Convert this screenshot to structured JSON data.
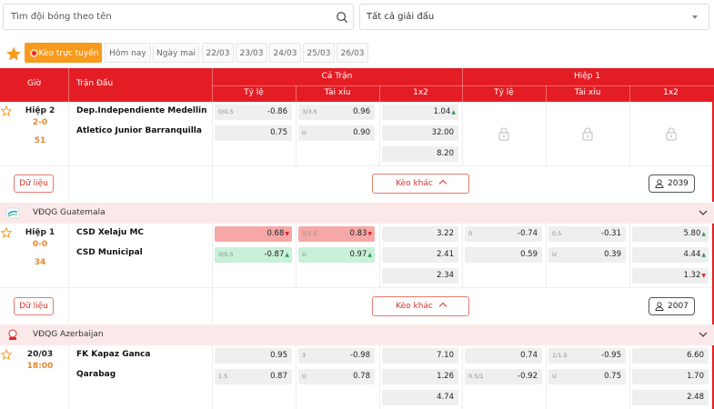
{
  "search": {
    "placeholder": "Tìm đội bóng theo tên",
    "league_select": "Tất cả giải đấu"
  },
  "tabs": [
    "Kèo trực tuyến",
    "Hôm nay",
    "Ngày mai",
    "22/03",
    "23/03",
    "24/03",
    "25/03",
    "26/03"
  ],
  "header": {
    "time": "Giờ",
    "match": "Trận Đấu",
    "full": "Cả Trận",
    "half": "Hiệp 1",
    "handicap": "Tỷ lệ",
    "overunder": "Tài xỉu",
    "onextwo": "1x2"
  },
  "buttons": {
    "data": "Dữ liệu",
    "more": "Kèo khác"
  },
  "leagues": [
    "VĐQG Guatemala",
    "VĐQG Azerbaijan"
  ],
  "matches": [
    {
      "time": "Hiệp 2",
      "score": "2-0",
      "minute": "51",
      "home": "Dep.Independiente Medellin",
      "away": "Atletico Junior Barranquilla",
      "full": {
        "hdp": [
          {
            "line": "0/0.5",
            "val": "-0.86"
          },
          {
            "line": "",
            "val": "0.75"
          }
        ],
        "ou": [
          {
            "line": "3/3.5",
            "val": "0.96"
          },
          {
            "line": "U",
            "val": "0.90"
          }
        ],
        "x12": [
          "1.04",
          "32.00",
          "8.20"
        ]
      },
      "viewers": "2039"
    },
    {
      "time": "Hiệp 1",
      "score": "0-0",
      "minute": "34",
      "home": "CSD Xelaju MC",
      "away": "CSD Municipal",
      "full": {
        "hdp": [
          {
            "line": "",
            "val": "0.68"
          },
          {
            "line": "0/0.5",
            "val": "-0.87"
          }
        ],
        "ou": [
          {
            "line": "1/1.5",
            "val": "0.83"
          },
          {
            "line": "U",
            "val": "0.97"
          }
        ],
        "x12": [
          "3.22",
          "2.41",
          "2.34"
        ]
      },
      "half": {
        "hdp": [
          {
            "line": "0",
            "val": "-0.74"
          },
          {
            "line": "",
            "val": "0.59"
          }
        ],
        "ou": [
          {
            "line": "0.5",
            "val": "-0.31"
          },
          {
            "line": "U",
            "val": "0.39"
          }
        ],
        "x12": [
          "5.80",
          "4.44",
          "1.32"
        ]
      },
      "viewers": "2007"
    },
    {
      "time": "20/03",
      "kickoff": "18:00",
      "home": "FK Kapaz Ganca",
      "away": "Qarabag",
      "full": {
        "hdp": [
          {
            "line": "",
            "val": "0.95"
          },
          {
            "line": "1.5",
            "val": "0.87"
          }
        ],
        "ou": [
          {
            "line": "3",
            "val": "-0.98"
          },
          {
            "line": "U",
            "val": "0.78"
          }
        ],
        "x12": [
          "7.10",
          "1.26",
          "4.74"
        ]
      },
      "half": {
        "hdp": [
          {
            "line": "",
            "val": "0.74"
          },
          {
            "line": "0.5/1",
            "val": "-0.92"
          }
        ],
        "ou": [
          {
            "line": "1/1.5",
            "val": "-0.95"
          },
          {
            "line": "U",
            "val": "0.75"
          }
        ],
        "x12": [
          "6.60",
          "1.70",
          "2.48"
        ]
      }
    }
  ],
  "colors": {
    "brand_red": "#e41c23",
    "live_orange": "#f79a1e",
    "score_orange": "#e8862a",
    "up_green": "#2a9d4e",
    "league_bg": "#fbe9e9"
  }
}
